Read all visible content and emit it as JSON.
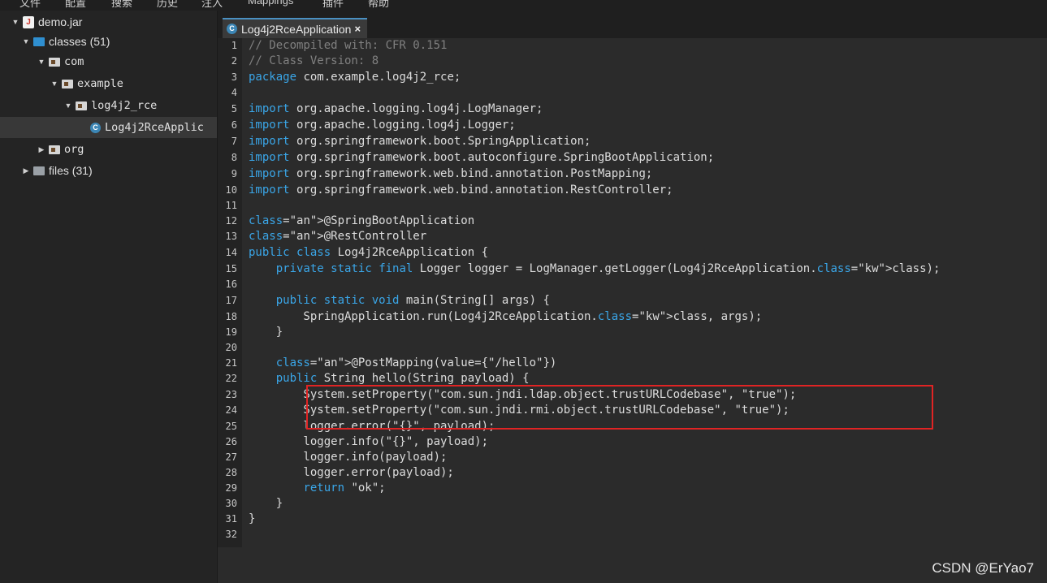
{
  "menu": [
    "文件",
    "配置",
    "搜索",
    "历史",
    "注入",
    "Mappings",
    "插件",
    "帮助"
  ],
  "tree": {
    "jar": "demo.jar",
    "classes": "classes (51)",
    "com": "com",
    "example": "example",
    "pkg": "log4j2_rce",
    "class_file": "Log4j2RceApplic",
    "org": "org",
    "files": "files (31)"
  },
  "tab": {
    "title": "Log4j2RceApplication",
    "close": "×",
    "icon": "C"
  },
  "code": [
    {
      "n": "1",
      "t": "// Decompiled with: CFR 0.151"
    },
    {
      "n": "2",
      "t": "// Class Version: 8"
    },
    {
      "n": "3",
      "t": "package com.example.log4j2_rce;"
    },
    {
      "n": "4",
      "t": ""
    },
    {
      "n": "5",
      "t": "import org.apache.logging.log4j.LogManager;"
    },
    {
      "n": "6",
      "t": "import org.apache.logging.log4j.Logger;"
    },
    {
      "n": "7",
      "t": "import org.springframework.boot.SpringApplication;"
    },
    {
      "n": "8",
      "t": "import org.springframework.boot.autoconfigure.SpringBootApplication;"
    },
    {
      "n": "9",
      "t": "import org.springframework.web.bind.annotation.PostMapping;"
    },
    {
      "n": "10",
      "t": "import org.springframework.web.bind.annotation.RestController;"
    },
    {
      "n": "11",
      "t": ""
    },
    {
      "n": "12",
      "t": "@SpringBootApplication"
    },
    {
      "n": "13",
      "t": "@RestController"
    },
    {
      "n": "14",
      "t": "public class Log4j2RceApplication {"
    },
    {
      "n": "15",
      "t": "    private static final Logger logger = LogManager.getLogger(Log4j2RceApplication.class);"
    },
    {
      "n": "16",
      "t": ""
    },
    {
      "n": "17",
      "t": "    public static void main(String[] args) {"
    },
    {
      "n": "18",
      "t": "        SpringApplication.run(Log4j2RceApplication.class, args);"
    },
    {
      "n": "19",
      "t": "    }"
    },
    {
      "n": "20",
      "t": ""
    },
    {
      "n": "21",
      "t": "    @PostMapping(value={\"/hello\"})"
    },
    {
      "n": "22",
      "t": "    public String hello(String payload) {"
    },
    {
      "n": "23",
      "t": "        System.setProperty(\"com.sun.jndi.ldap.object.trustURLCodebase\", \"true\");"
    },
    {
      "n": "24",
      "t": "        System.setProperty(\"com.sun.jndi.rmi.object.trustURLCodebase\", \"true\");"
    },
    {
      "n": "25",
      "t": "        logger.error(\"{}\", payload);"
    },
    {
      "n": "26",
      "t": "        logger.info(\"{}\", payload);"
    },
    {
      "n": "27",
      "t": "        logger.info(payload);"
    },
    {
      "n": "28",
      "t": "        logger.error(payload);"
    },
    {
      "n": "29",
      "t": "        return \"ok\";"
    },
    {
      "n": "30",
      "t": "    }"
    },
    {
      "n": "31",
      "t": "}"
    },
    {
      "n": "32",
      "t": ""
    }
  ],
  "watermark": "CSDN @ErYao7",
  "colors": {
    "keyword": "#3aa6e8",
    "comment": "#808080",
    "highlight_border": "#e02424",
    "tab_accent": "#4a90c2"
  },
  "icons": {
    "jar": "jar-icon",
    "folder": "folder-icon",
    "package": "package-icon",
    "class": "class-icon",
    "expand": "chevron-down-icon",
    "collapse": "chevron-right-icon"
  }
}
